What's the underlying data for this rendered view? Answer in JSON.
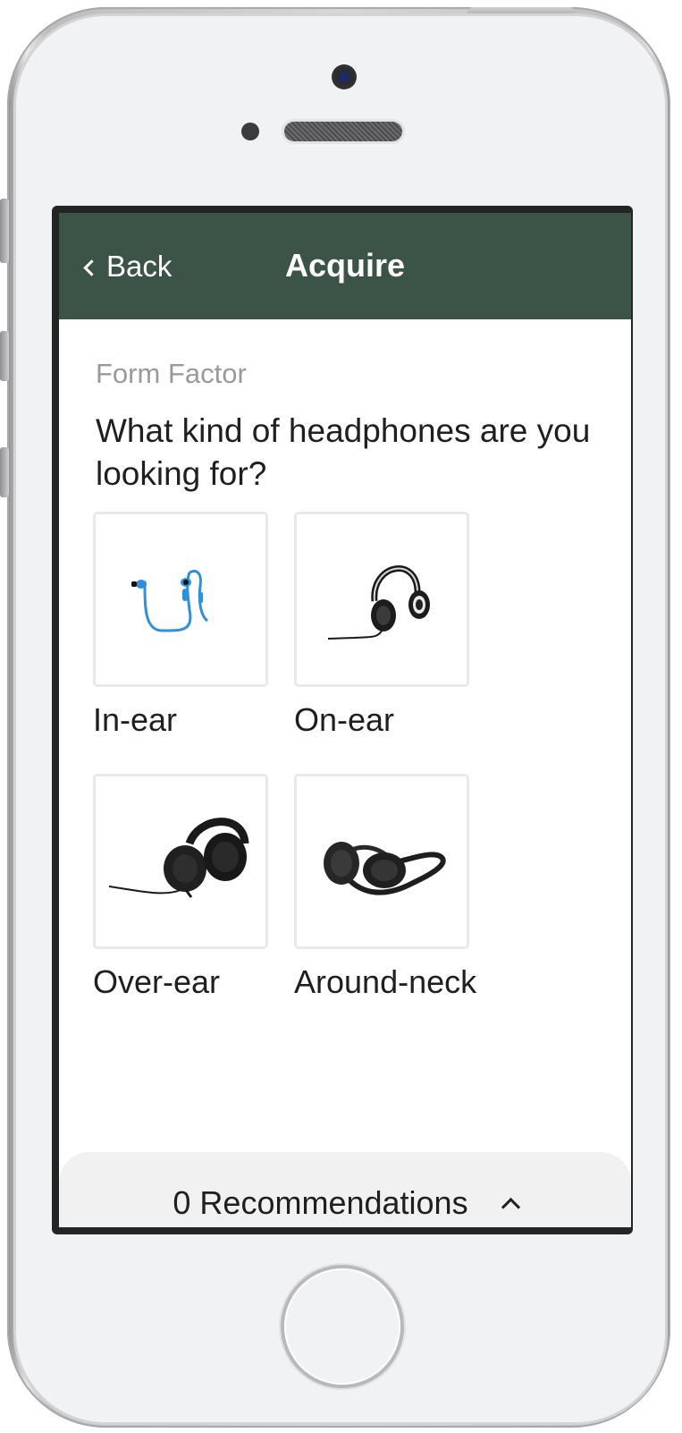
{
  "header": {
    "back_label": "Back",
    "title": "Acquire",
    "background_color": "#3b5447"
  },
  "step": {
    "label": "Form Factor",
    "question": "What kind of headphones are you looking for?"
  },
  "options": [
    {
      "label": "In-ear",
      "icon": "in-ear-headphones-icon",
      "accent": "#2f8fd8"
    },
    {
      "label": "On-ear",
      "icon": "on-ear-headphones-icon"
    },
    {
      "label": "Over-ear",
      "icon": "over-ear-headphones-icon"
    },
    {
      "label": "Around-neck",
      "icon": "around-neck-headphones-icon"
    }
  ],
  "footer": {
    "recommendations_label": "0 Recommendations",
    "toggle_icon": "chevron-up-icon"
  }
}
